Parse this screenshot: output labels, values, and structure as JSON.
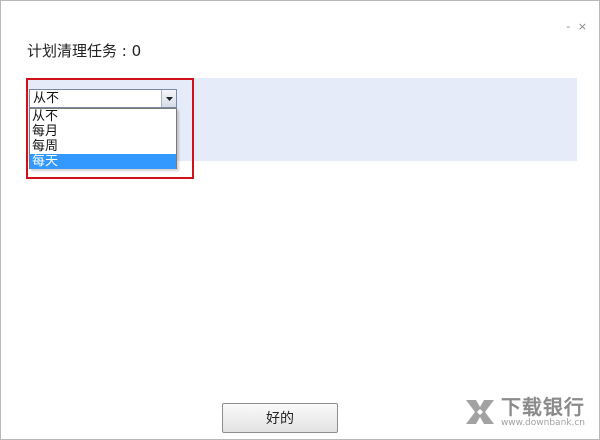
{
  "window": {
    "controls": [
      "-",
      "×"
    ]
  },
  "heading": {
    "label": "计划清理任务 : 0"
  },
  "schedule_select": {
    "value": "从不",
    "options": [
      {
        "label": "从不",
        "selected": false
      },
      {
        "label": "每月",
        "selected": false
      },
      {
        "label": "每周",
        "selected": false
      },
      {
        "label": "每天",
        "selected": true
      }
    ]
  },
  "footer": {
    "ok_label": "好的"
  },
  "watermark": {
    "name": "下载银行",
    "url": "www.downbank.cn"
  },
  "colors": {
    "band": "#e6ebfa",
    "highlight_border": "#d0101a",
    "selected_option": "#3399ff"
  },
  "icons": [
    "chevron-down-icon",
    "minimize-icon",
    "close-icon",
    "downbank-logo-icon"
  ]
}
